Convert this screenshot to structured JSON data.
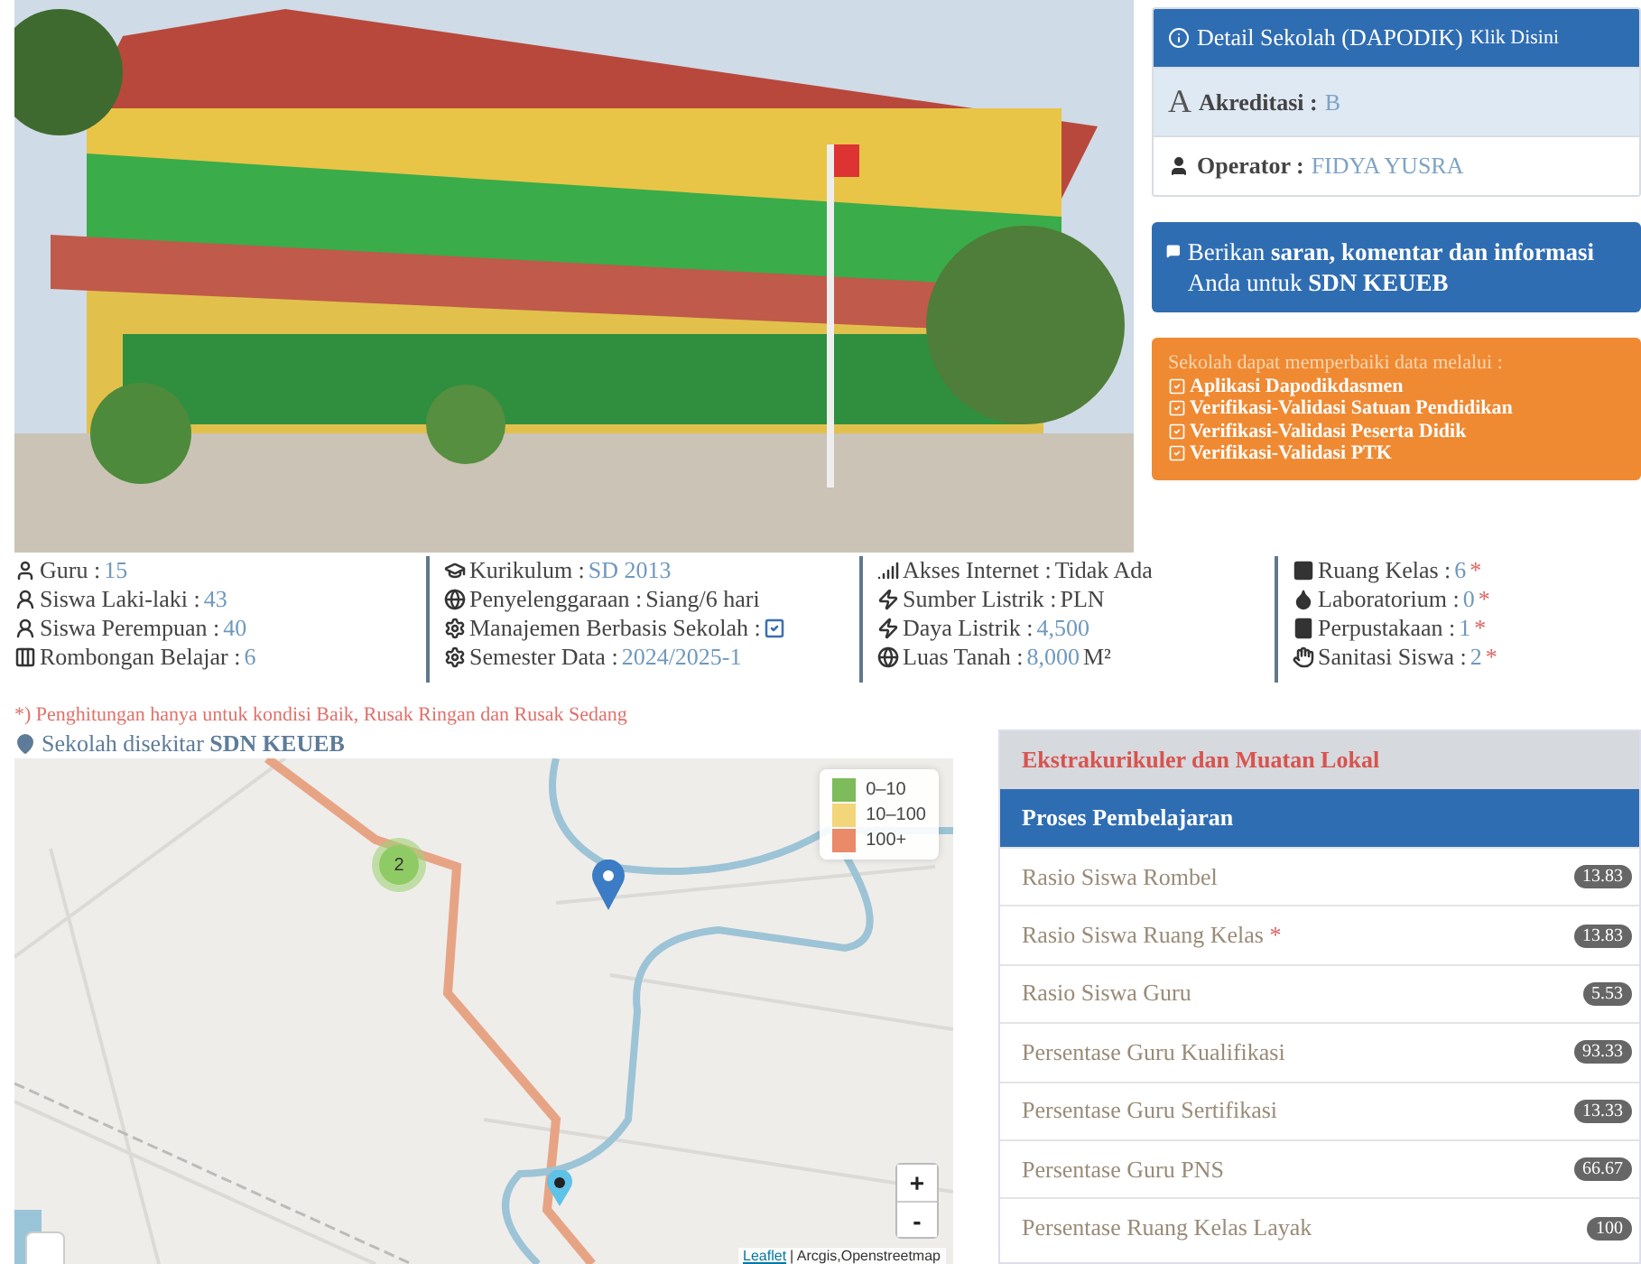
{
  "detail_panel": {
    "title": "Detail Sekolah (DAPODIK)",
    "link": "Klik Disini",
    "accreditation": {
      "icon_letter": "A",
      "label": "Akreditasi :",
      "value": "B"
    },
    "operator": {
      "label": "Operator :",
      "value": "FIDYA YUSRA"
    }
  },
  "feedback_panel": {
    "text": "Berikan **saran, komentar dan informasi** Anda untuk **SDN KEUEB**"
  },
  "update_panel": {
    "intro": "Sekolah dapat memperbaiki data melalui :",
    "links": [
      "Aplikasi Dapodikdasmen",
      "Verifikasi-Validasi Satuan Pendidikan",
      "Verifikasi-Validasi Peserta Didik",
      "Verifikasi-Validasi PTK"
    ]
  },
  "stats": [
    [
      {
        "label": "Guru :",
        "kind": "link",
        "value": "15"
      },
      {
        "label": "Siswa Laki-laki :",
        "kind": "link",
        "value": "43"
      },
      {
        "label": "Siswa Perempuan :",
        "kind": "link",
        "value": "40"
      },
      {
        "label": "Rombongan Belajar :",
        "kind": "link",
        "value": "6"
      }
    ],
    [
      {
        "label": "Kurikulum :",
        "kind": "link",
        "value": "SD 2013"
      },
      {
        "label": "Penyelenggaraan :",
        "kind": "plain",
        "value": "Siang/6 hari"
      },
      {
        "label": "Manajemen Berbasis Sekolah :",
        "kind": "check",
        "checked": true
      },
      {
        "label": "Semester Data :",
        "kind": "link",
        "value": "2024/2025-1"
      }
    ],
    [
      {
        "label": "Akses Internet :",
        "kind": "plain",
        "value": "Tidak Ada"
      },
      {
        "label": "Sumber Listrik :",
        "kind": "plain",
        "value": "PLN"
      },
      {
        "label": "Daya Listrik :",
        "kind": "link",
        "value": "4,500"
      },
      {
        "label": "Luas Tanah :",
        "kind": "link",
        "value": "8,000",
        "unit": "M²"
      }
    ],
    [
      {
        "label": "Ruang Kelas :",
        "kind": "link",
        "value": "6",
        "note_mark": "*"
      },
      {
        "label": "Laboratorium :",
        "kind": "link",
        "value": "0",
        "note_mark": "*"
      },
      {
        "label": "Perpustakaan :",
        "kind": "link",
        "value": "1",
        "note_mark": "*"
      },
      {
        "label": "Sanitasi Siswa :",
        "kind": "link",
        "value": "2",
        "note_mark": "*"
      }
    ]
  ],
  "footnote": "*) Penghitungan hanya untuk kondisi Baik, Rusak Ringan dan Rusak Sedang",
  "nearby_title": "Sekolah disekitar **SDN KEUEB**",
  "map": {
    "legend": [
      {
        "label": "0–10",
        "color": "#7dbb5b"
      },
      {
        "label": "10–100",
        "color": "#f3d57a"
      },
      {
        "label": "100+",
        "color": "#ea8a68"
      }
    ],
    "cluster": "2",
    "zoom": [
      "+",
      "-"
    ],
    "attribution": {
      "link": "Leaflet",
      "text": "| Arcgis,Openstreetmap"
    }
  },
  "sections": [
    {
      "label": "Ekstrakurikuler dan Muatan Lokal",
      "selected": false
    },
    {
      "label": "Proses Pembelajaran",
      "selected": true
    }
  ],
  "metrics": [
    {
      "label": "Rasio Siswa Rombel",
      "value": "13.83"
    },
    {
      "label": "Rasio Siswa Ruang Kelas",
      "value": "13.83",
      "note_mark": "*"
    },
    {
      "label": "Rasio Siswa Guru",
      "value": "5.53"
    },
    {
      "label": "Persentase Guru Kualifikasi",
      "value": "93.33"
    },
    {
      "label": "Persentase Guru Sertifikasi",
      "value": "13.33"
    },
    {
      "label": "Persentase Guru PNS",
      "value": "66.67"
    },
    {
      "label": "Persentase Ruang Kelas Layak",
      "value": "100"
    }
  ]
}
